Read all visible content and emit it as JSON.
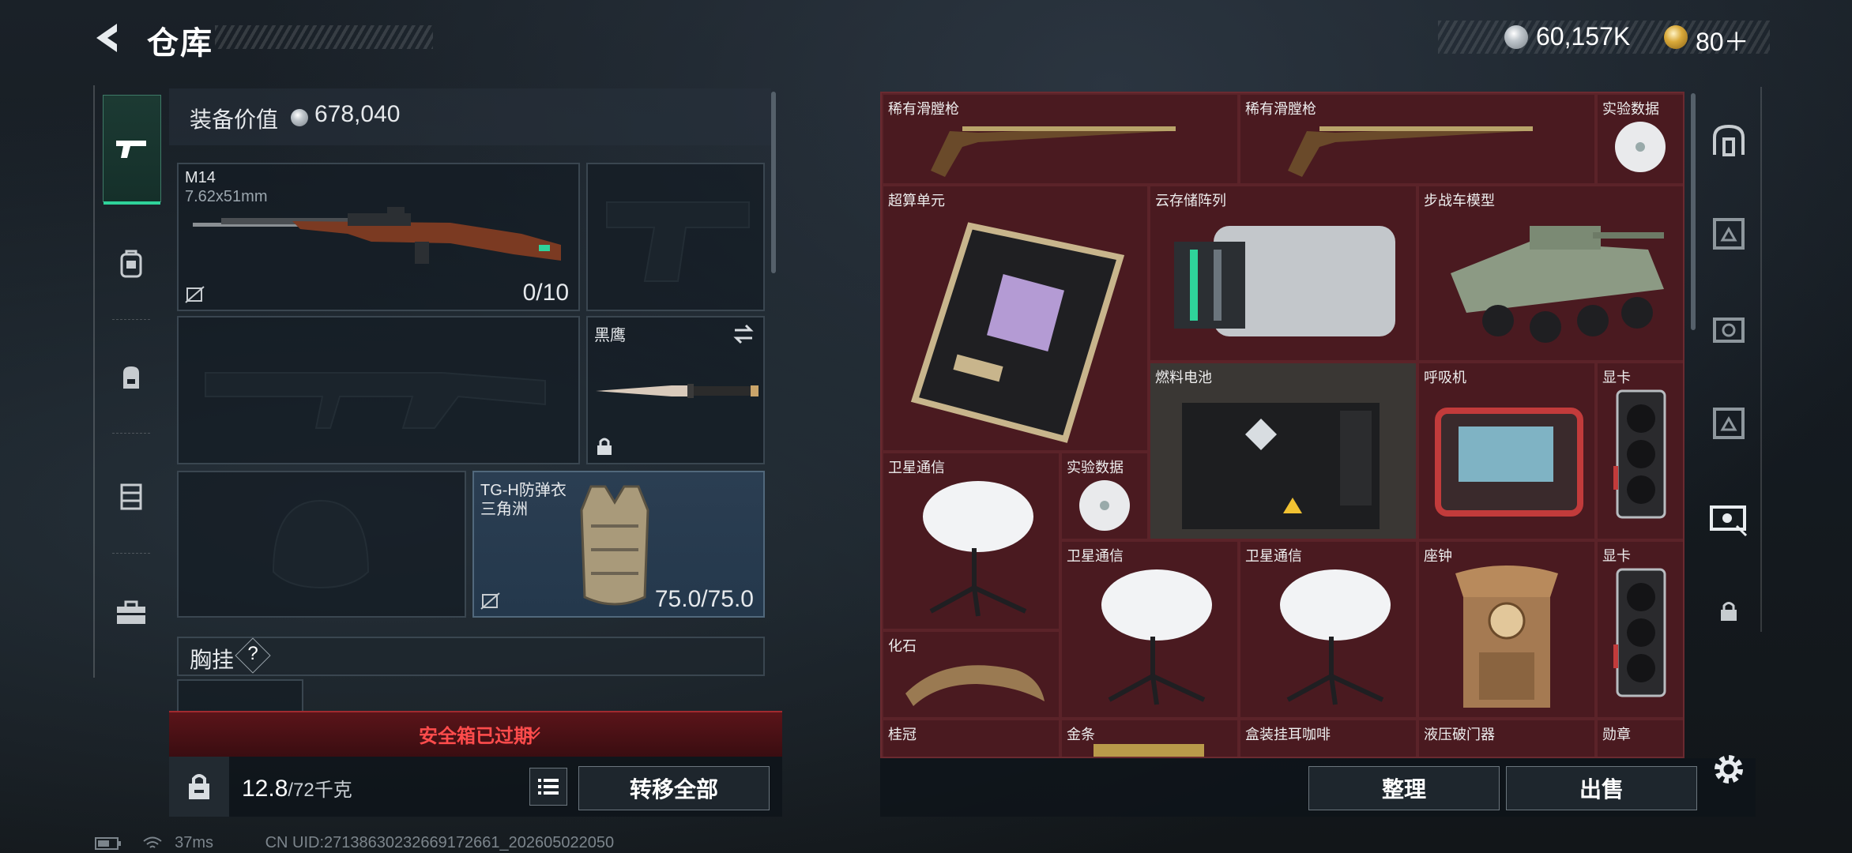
{
  "header": {
    "title": "仓库",
    "back_icon": "back-arrow-icon"
  },
  "currency": {
    "silver_value": "60,157K",
    "gold_value": "80＋"
  },
  "left_nav": {
    "items": [
      "pistol-icon",
      "backpack-armor-icon",
      "backpack-icon",
      "chest-rig-icon",
      "toolbox-icon"
    ]
  },
  "loadout": {
    "value_label": "装备价值",
    "value_number": "678,040",
    "primary_weapon": {
      "name": "M14",
      "caliber": "7.62x51mm",
      "ammo": "0/10"
    },
    "melee": {
      "name": "黑鹰"
    },
    "armor": {
      "name": "TG-H防弹衣",
      "sub": "三角洲",
      "durability": "75.0/75.0"
    },
    "chest_rig_label": "胸挂",
    "help_mark": "?",
    "safe_box_status": "安全箱已过期",
    "weight_current": "12.8",
    "weight_capacity": "/72千克",
    "transfer_all_label": "转移全部"
  },
  "storage": {
    "items": [
      {
        "name": "稀有滑膛枪"
      },
      {
        "name": "稀有滑膛枪"
      },
      {
        "name": "实验数据"
      },
      {
        "name": "超算单元"
      },
      {
        "name": "云存储阵列"
      },
      {
        "name": "步战车模型"
      },
      {
        "name": "燃料电池"
      },
      {
        "name": "呼吸机"
      },
      {
        "name": "显卡"
      },
      {
        "name": "卫星通信"
      },
      {
        "name": "实验数据"
      },
      {
        "name": "卫星通信"
      },
      {
        "name": "卫星通信"
      },
      {
        "name": "座钟"
      },
      {
        "name": "显卡"
      },
      {
        "name": "化石"
      },
      {
        "name": "桂冠"
      },
      {
        "name": "金条"
      },
      {
        "name": "盒装挂耳咖啡"
      },
      {
        "name": "液压破门器"
      },
      {
        "name": "勋章"
      }
    ],
    "organize_label": "整理",
    "sell_label": "出售"
  },
  "right_nav": {
    "items": [
      "safe-icon",
      "container-icon",
      "camera-case-icon",
      "container-icon-2",
      "ticket-icon",
      "lock-icon"
    ],
    "settings_icon": "gear-icon"
  },
  "status_bar": {
    "ping": "37ms",
    "uid": "CN UID:27138630232669172661_202605022050"
  },
  "colors": {
    "accent_green": "#2fd39a",
    "storage_bg": "#3c1419",
    "warning_red": "#ff4c4c"
  }
}
